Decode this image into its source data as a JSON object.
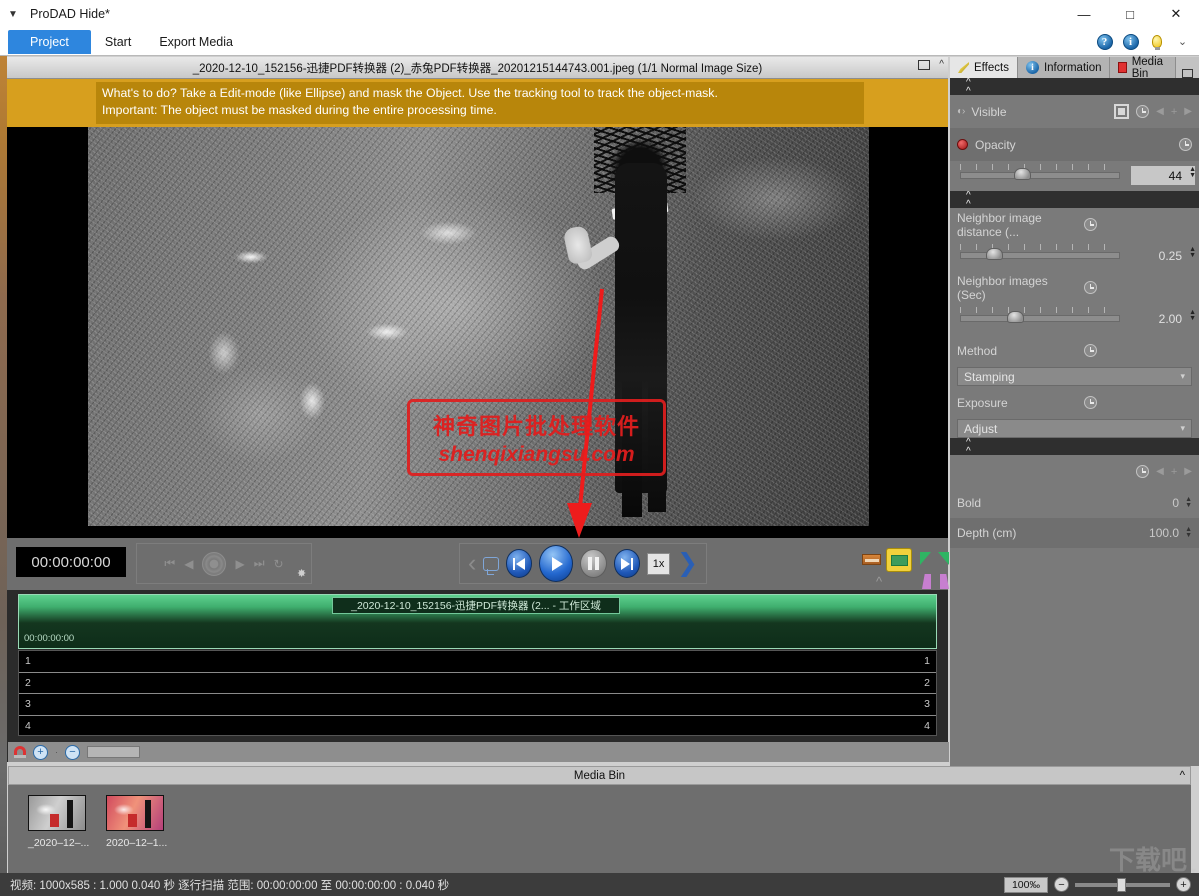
{
  "window": {
    "title": "ProDAD Hide*",
    "caret_icon": "caret-down-icon",
    "minimize": "—",
    "maximize": "□",
    "close": "✕"
  },
  "menubar": {
    "project": "Project",
    "items": [
      "Start",
      "Export Media"
    ],
    "icons": [
      "help-icon",
      "information-icon",
      "tip-bulb-icon",
      "chevron-down-icon"
    ],
    "help_glyph": "?",
    "info_glyph": "i",
    "chevron_glyph": "⌄"
  },
  "preview": {
    "title": "_2020-12-10_152156-迅捷PDF转换器 (2)_赤兔PDF转换器_20201215144743.001.jpeg   (1/1  Normal Image Size)",
    "banner_line1": "What's to do?  Take a Edit-mode (like Ellipse) and mask the Object. Use the tracking tool to track the object-mask.",
    "banner_line2": "Important: The object must be masked during the entire processing time.",
    "watermark_cn": "神奇图片批处理软件",
    "watermark_en": "shenqixiangsu.com",
    "banner_color": "#b8860b",
    "arrow_color": "#ee1c1c"
  },
  "transport": {
    "timecode": "00:00:00:00",
    "speed": "1x",
    "nav_icons": [
      "skip-start-icon",
      "step-back-icon",
      "record-icon",
      "step-forward-icon",
      "skip-end-icon",
      "loop-refresh-icon"
    ],
    "gear_icon": "gear-icon",
    "play_icons": [
      "chevron-left-icon",
      "loop-icon",
      "skip-back-icon",
      "play-icon",
      "pause-icon",
      "skip-forward-icon",
      "chevron-right-icon"
    ],
    "marker_icons": [
      "trim-in-icon",
      "workarea-icon",
      "green-triangle-left-icon",
      "green-triangle-right-icon",
      "caret-up-icon",
      "magenta-marker-left-icon",
      "magenta-marker-right-icon"
    ]
  },
  "timeline": {
    "clip_label": "_2020-12-10_152156-迅捷PDF转换器 (2... - 工作区域",
    "start_timecode": "00:00:00:00",
    "tracks": [
      "1",
      "2",
      "3",
      "4"
    ],
    "magnet_icon": "magnet-snap-icon",
    "zoom_in": "+",
    "zoom_out": "−",
    "zoom_dot": "·"
  },
  "media_bin": {
    "header": "Media Bin",
    "items": [
      {
        "label": "_2020–12–...",
        "thumb": "gray"
      },
      {
        "label": "2020–12–1...",
        "thumb": "pink"
      }
    ],
    "caret_icon": "chevron-up-icon"
  },
  "right_panel": {
    "tabs": [
      {
        "label": "Effects",
        "icon": "pencil-icon",
        "active": true
      },
      {
        "label": "Information",
        "icon": "info-icon",
        "active": false
      },
      {
        "label": "Media Bin",
        "icon": "red-square-icon",
        "active": false
      }
    ],
    "visible_label": "Visible",
    "opacity_label": "Opacity",
    "opacity_value": "44",
    "neighbor_distance_label": "Neighbor image distance (...",
    "neighbor_distance_value": "0.25",
    "neighbor_images_label": "Neighbor images (Sec)",
    "neighbor_images_value": "2.00",
    "method_label": "Method",
    "method_value": "Stamping",
    "exposure_label": "Exposure",
    "exposure_value": "Adjust",
    "bold_label": "Bold",
    "bold_value": "0",
    "depth_label": "Depth (cm)",
    "depth_value": "100.0",
    "collapse_icon": "double-chevron-up-icon",
    "keyframe_icon": "keyframe-clock-icon",
    "prev_key_icon": "prev-keyframe-icon",
    "add_key_icon": "add-keyframe-icon",
    "next_key_icon": "next-keyframe-icon",
    "eye_icon": "eye-icon"
  },
  "statusbar": {
    "text": "视频: 1000x585 : 1.000  0.040 秒  逐行扫描  范围: 00:00:00:00 至 00:00:00:00 : 0.040 秒",
    "zoom": "100‰",
    "zoom_out": "−",
    "zoom_in": "+",
    "watermark": "下载吧"
  }
}
